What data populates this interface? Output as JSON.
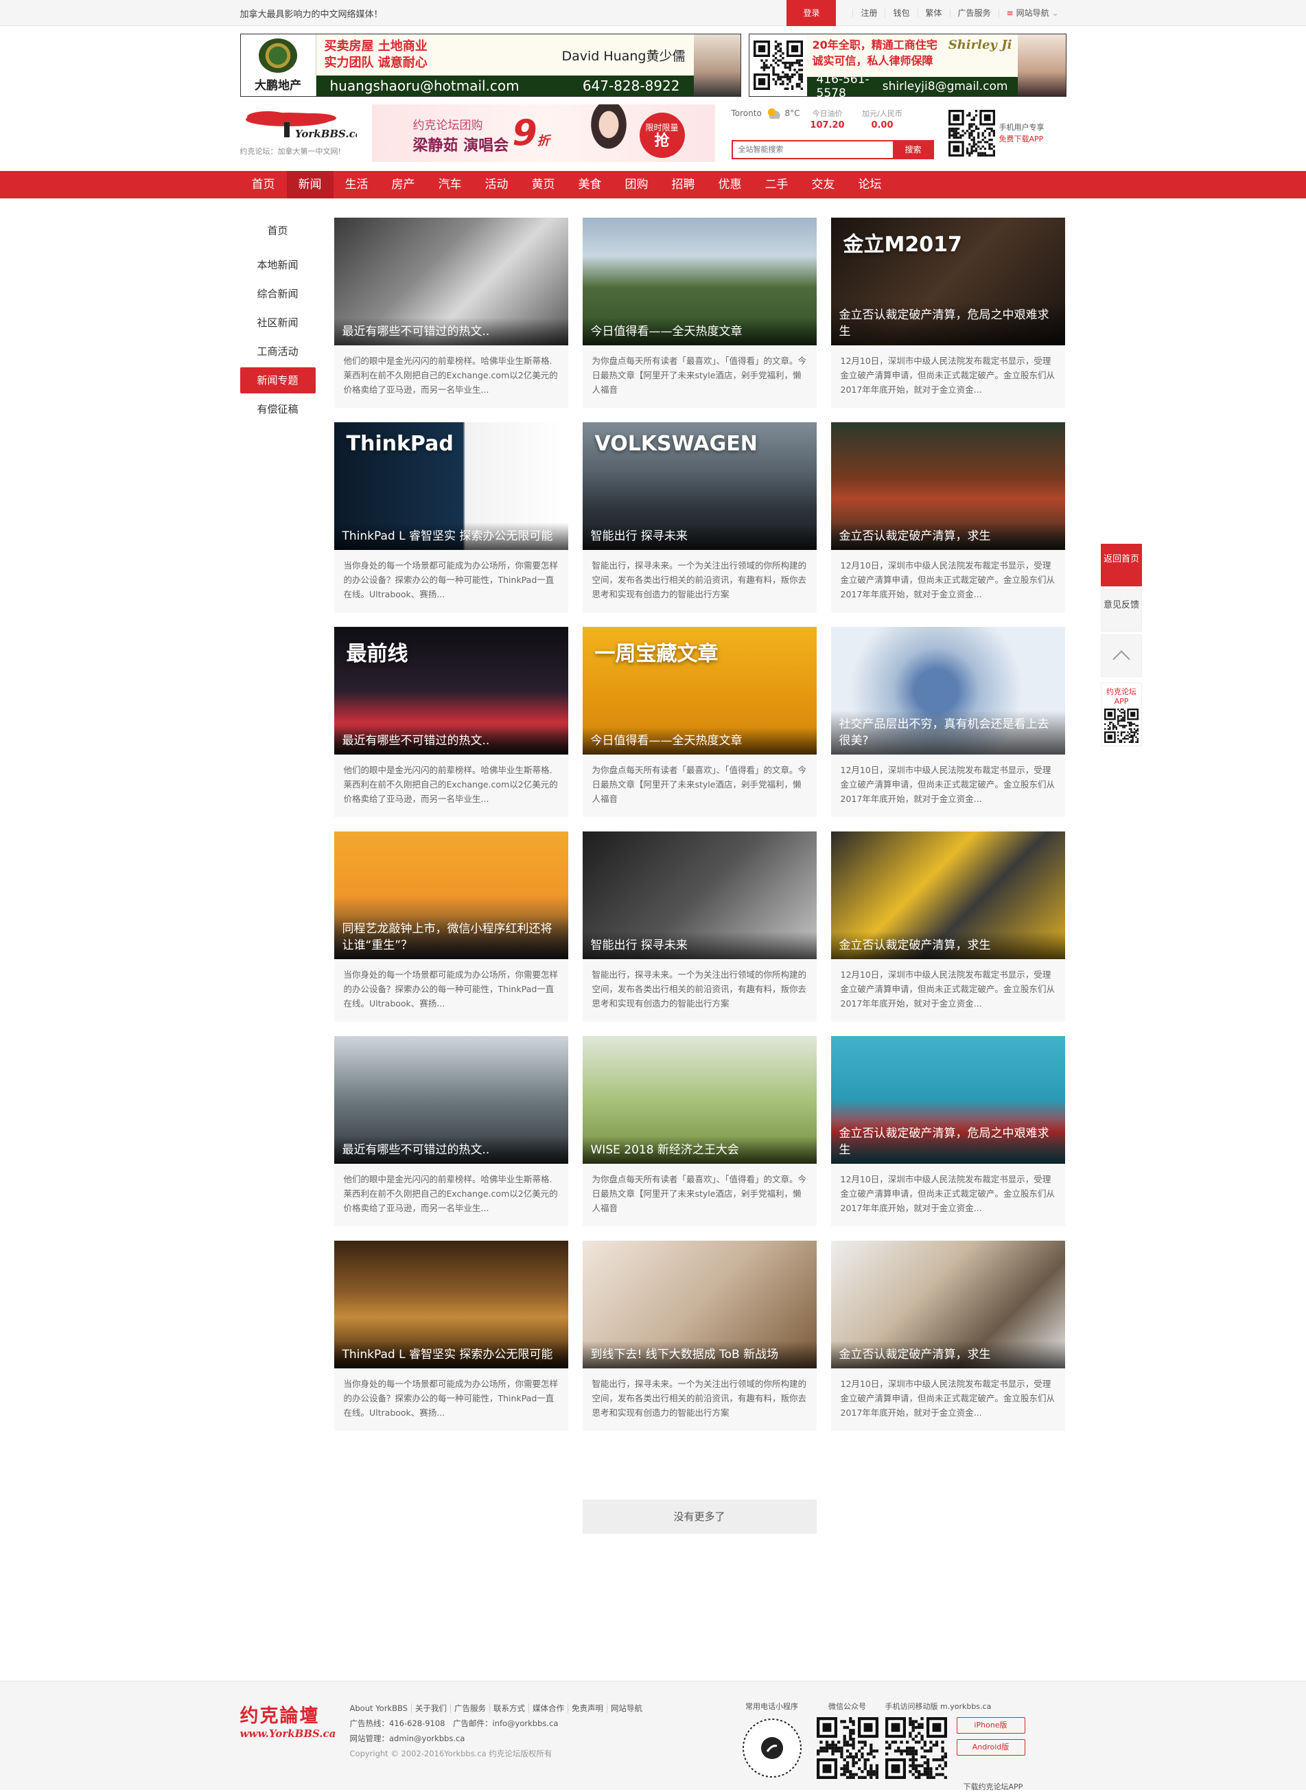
{
  "topbar": {
    "slogan": "加拿大最具影响力的中文网络媒体！",
    "login": "登录",
    "links": [
      "注册",
      "钱包",
      "繁体",
      "广告服务"
    ],
    "site_nav": "网站导航"
  },
  "ads": {
    "ad1": {
      "brand": "大鹏地产",
      "line1": "买卖房屋 土地商业",
      "line2": "实力团队 诚意耐心",
      "agent": "David Huang黄少儒",
      "email": "huangshaoru@hotmail.com",
      "phone": "647-828-8922"
    },
    "ad2": {
      "line1": "20年全职，精通工商住宅",
      "line2": "诚实可信，私人律师保障",
      "signature": "Shirley Ji",
      "phone": "416-561-5578",
      "email": "shirleyji8@gmail.com"
    }
  },
  "header": {
    "brand_logo": "YorkBBS.ca",
    "brand_sub": "约克论坛：加拿大第一中文网!",
    "banner": {
      "l1": "约克论坛团购",
      "l2": "梁静茹 演唱会",
      "discount": "9",
      "discount_unit": "折",
      "tag1": "限时限量",
      "tag2": "抢"
    },
    "weather": {
      "city": "Toronto",
      "temp": "8°C"
    },
    "oil": {
      "label": "今日油价",
      "value": "107.20"
    },
    "fx": {
      "label": "加元/人民币",
      "value": "0.00"
    },
    "search_placeholder": "全站智能搜索",
    "search_button": "搜索",
    "app": {
      "t1": "手机用户专享",
      "t2": "免费下载APP"
    }
  },
  "nav": [
    "首页",
    "新闻",
    "生活",
    "房产",
    "汽车",
    "活动",
    "黄页",
    "美食",
    "团购",
    "招聘",
    "优惠",
    "二手",
    "交友",
    "论坛"
  ],
  "nav_active": 1,
  "side_menu": [
    "首页",
    "本地新闻",
    "综合新闻",
    "社区新闻",
    "工商活动",
    "新闻专题",
    "有偿征稿"
  ],
  "side_active": 5,
  "desc_texts": {
    "a": "他们的眼中是金光闪闪的前辈榜样。哈佛毕业生斯蒂格.莱西利在前不久刚把自己的Exchange.com以2亿美元的价格卖给了亚马逊，而另一名毕业生...",
    "b": "为你盘点每天所有读者「最喜欢」、「值得看」的文章。今日最热文章【阿里开了未来style酒店，剁手党福利，懒人福音",
    "c": "12月10日，深圳市中级人民法院发布裁定书显示，受理金立破产清算申请，但尚未正式裁定破产。金立股东们从2017年年底开始，就对于金立资金...",
    "d": "当你身处的每一个场景都可能成为办公场所，你需要怎样的办公设备？探索办公的每一种可能性，ThinkPad一直在线。Ultrabook、赛扬...",
    "e": "智能出行，探寻未来。一个为关注出行领域的你所构建的空间，发布各类出行相关的前沿资讯，有趣有料，叛你去思考和实现有创造力的智能出行方案"
  },
  "cards": [
    {
      "title": "最近有哪些不可错过的热文..",
      "desc": "a",
      "img_icon": "office-desk-image"
    },
    {
      "title": "今日值得看——全天热度文章",
      "desc": "b",
      "img_icon": "alpine-village-image"
    },
    {
      "title": "金立否认裁定破产清算，危局之中艰难求生",
      "desc": "c",
      "img_icon": "gionee-event-image",
      "overlay": "金立M2017"
    },
    {
      "title": "ThinkPad L 睿智坚实 探索办公无限可能",
      "desc": "d",
      "img_icon": "thinkpad-ad-image",
      "overlay": "ThinkPad"
    },
    {
      "title": "智能出行 探寻未来",
      "desc": "e",
      "img_icon": "volkswagen-road-image",
      "overlay": "VOLKSWAGEN"
    },
    {
      "title": "金立否认裁定破产清算，求生",
      "desc": "c",
      "img_icon": "red-house-image"
    },
    {
      "title": "最近有哪些不可错过的热文..",
      "desc": "a",
      "img_icon": "audi-car-image",
      "overlay": "最前线"
    },
    {
      "title": "今日值得看——全天热度文章",
      "desc": "b",
      "img_icon": "week-banner-image",
      "overlay": "一周宝藏文章"
    },
    {
      "title": "社交产品层出不穷，真有机会还是看上去很美?",
      "desc": "c",
      "img_icon": "world-map-photos-image"
    },
    {
      "title": "同程艺龙敲钟上市，微信小程序红利还将让谁“重生”？",
      "desc": "d",
      "img_icon": "illustration-man-image"
    },
    {
      "title": "智能出行 探寻未来",
      "desc": "e",
      "img_icon": "laptop-coffee-image"
    },
    {
      "title": "金立否认裁定破产清算，求生",
      "desc": "c",
      "img_icon": "yellow-taxis-image"
    },
    {
      "title": "最近有哪些不可错过的热文..",
      "desc": "a",
      "img_icon": "telescope-man-image"
    },
    {
      "title": "WISE 2018 新经济之王大会",
      "desc": "b",
      "img_icon": "meadow-girl-image"
    },
    {
      "title": "金立否认裁定破产清算，危局之中艰难求生",
      "desc": "c",
      "img_icon": "laughing-man-image"
    },
    {
      "title": "ThinkPad L 睿智坚实 探索办公无限可能",
      "desc": "d",
      "img_icon": "library-image"
    },
    {
      "title": "到线下去! 线下大数据成 ToB 新战场",
      "desc": "e",
      "img_icon": "music-sheet-image"
    },
    {
      "title": "金立否认裁定破产清算，求生",
      "desc": "c",
      "img_icon": "breakfast-desk-image"
    }
  ],
  "load_more": "没有更多了",
  "float": {
    "top": "返回首页",
    "feedback": "意见反馈",
    "app": "约克论坛APP"
  },
  "footer": {
    "logo_cn": "约克論壇",
    "logo_en": "www.YorkBBS.ca",
    "links": [
      "About YorkBBS",
      "关于我们",
      "广告服务",
      "联系方式",
      "媒体合作",
      "免责声明",
      "网站导航"
    ],
    "hotline": "广告热线：416-628-9108",
    "ad_email": "广告邮件：info@yorkbbs.ca",
    "admin": "网站管理：admin@yorkbbs.ca",
    "copyright": "Copyright © 2002-2016Yorkbbs.ca 约克论坛版权所有",
    "mini_program": "常用电话小程序",
    "wechat": "微信公众号",
    "mobile": "手机访问移动版 m.yorkbbs.ca",
    "iphone": "iPhone版",
    "android": "Android版",
    "download": "下载约克论坛APP"
  }
}
